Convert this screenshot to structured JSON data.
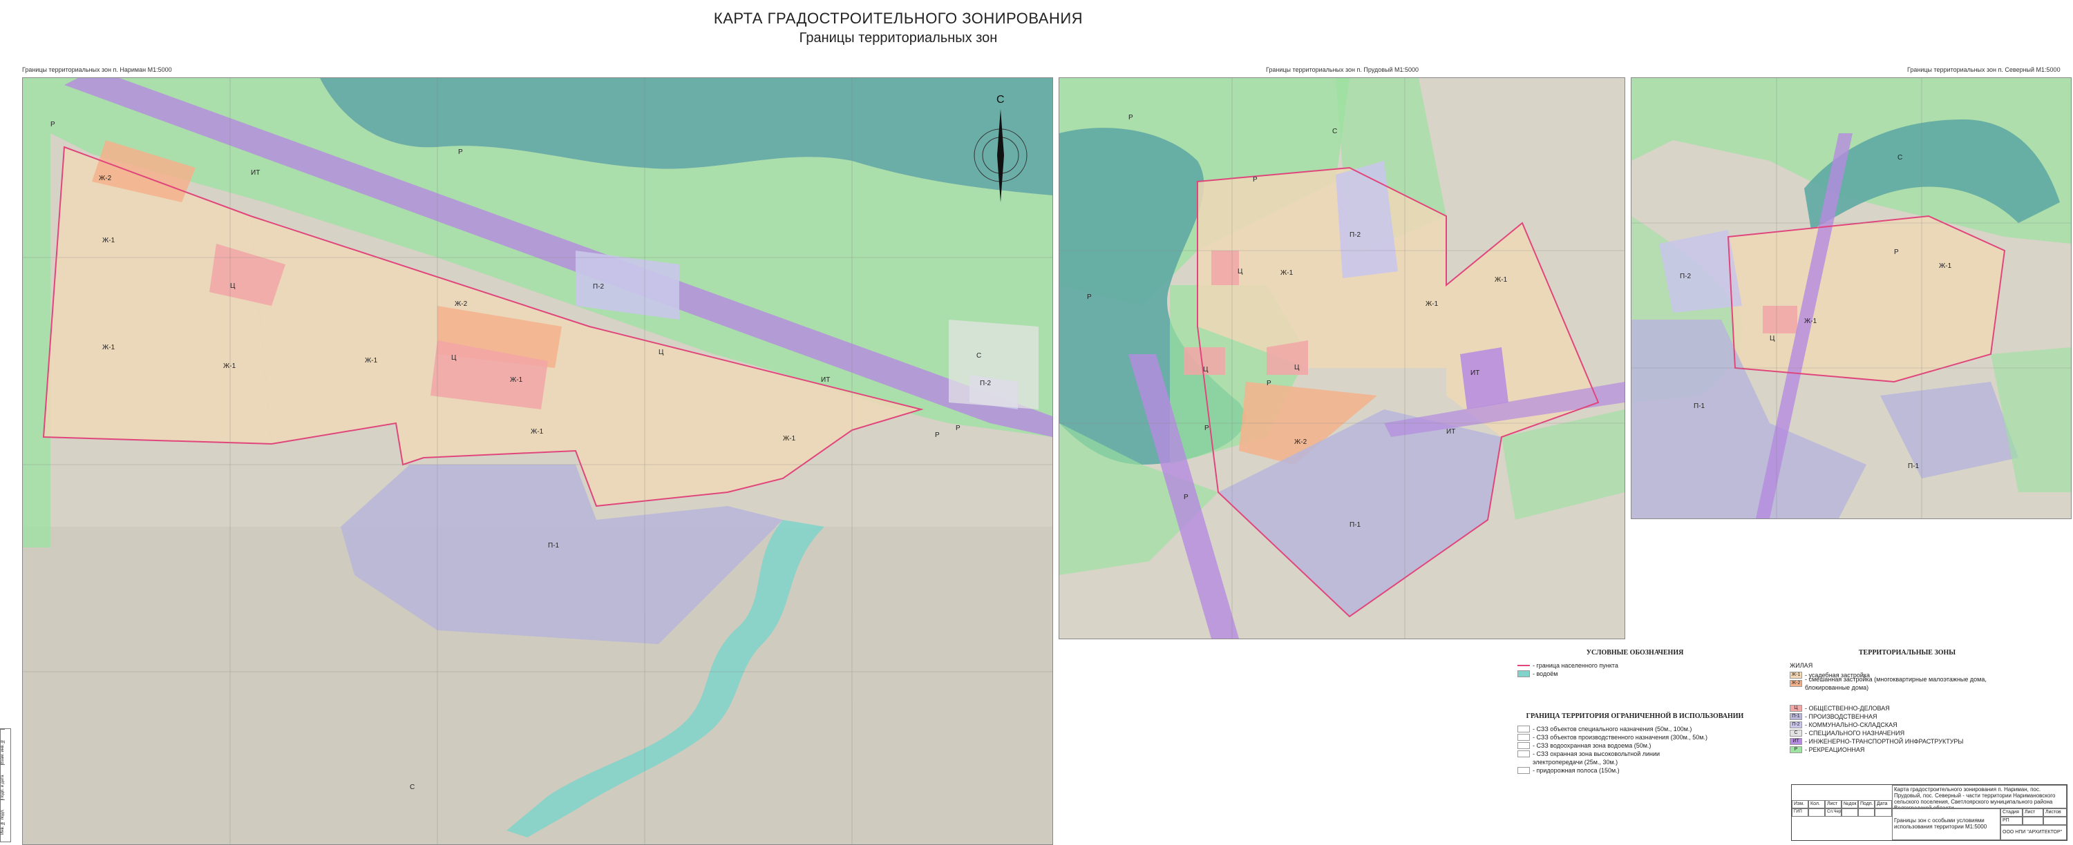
{
  "header": {
    "title": "КАРТА ГРАДОСТРОИТЕЛЬНОГО ЗОНИРОВАНИЯ",
    "subtitle": "Границы территориальных зон"
  },
  "maps": [
    {
      "caption": "Границы территориальных зон п. Нариман М1:5000",
      "north": "С",
      "labels": [
        "Р",
        "Ж-2",
        "ИТ",
        "Р",
        "Ж-1",
        "Ц",
        "Ж-1",
        "Ж-2",
        "Ц",
        "Ж-1",
        "Ж-1",
        "Ж-1",
        "П-2",
        "Ц",
        "Ж-1",
        "ИТ",
        "Ж-1",
        "Р",
        "С",
        "П-2",
        "Р",
        "П-1",
        "С"
      ]
    },
    {
      "caption": "Границы территориальных зон п. Прудовый М1:5000",
      "labels": [
        "Р",
        "С",
        "Р",
        "П-2",
        "Ж-1",
        "Ж-1",
        "Ж-1",
        "ИТ",
        "Ц",
        "Ц",
        "Ц",
        "Ж-2",
        "П-1",
        "Р",
        "Р",
        "Р",
        "ИТ",
        "Р"
      ]
    },
    {
      "caption": "Границы территориальных зон п. Северный М1:5000",
      "labels": [
        "С",
        "П-2",
        "Ж-1",
        "Ж-1",
        "Ц",
        "Р",
        "П-1",
        "П-1"
      ]
    }
  ],
  "legend_left": {
    "title": "УСЛОВНЫЕ ОБОЗНАЧЕНИЯ",
    "items": [
      {
        "label": "- граница населенного пункта",
        "kind": "line",
        "color": "#e0467c"
      },
      {
        "label": "- водоём",
        "kind": "fill",
        "color": "#7fd3c9"
      }
    ],
    "restricted_title": "ГРАНИЦА ТЕРРИТОРИЯ ОГРАНИЧЕННОЙ В ИСПОЛЬЗОВАНИИ",
    "restricted": [
      "- СЗЗ объектов специального назначения (50м., 100м.)",
      "- СЗЗ объектов производственного назначения (300м., 50м.)",
      "- СЗЗ водоохранная зона водоема (50м.)",
      "- СЗЗ охранная зона высоковольтной линии",
      "электропередачи (25м., 30м.)",
      "- придорожная полоса (150м.)"
    ]
  },
  "legend_right": {
    "title": "ТЕРРИТОРИАЛЬНЫЕ ЗОНЫ",
    "group_residential": "ЖИЛАЯ",
    "residential": [
      {
        "code": "Ж-1",
        "label": "- усадебная застройка",
        "color": "#f3d9b5"
      },
      {
        "code": "Ж-2",
        "label": "- смешанная застройка (многоквартирные малоэтажные дома, блокированные дома)",
        "color": "#f4b28c"
      }
    ],
    "zones": [
      {
        "code": "Ц",
        "label": "- ОБЩЕСТВЕННО-ДЕЛОВАЯ",
        "color": "#f2a6a6"
      },
      {
        "code": "П-1",
        "label": "- ПРОИЗВОДСТВЕННАЯ",
        "color": "#b9b6d9"
      },
      {
        "code": "П-2",
        "label": "- КОММУНАЛЬНО-СКЛАДСКАЯ",
        "color": "#c9c6ea"
      },
      {
        "code": "С",
        "label": "- СПЕЦИАЛЬНОГО НАЗНАЧЕНИЯ",
        "color": "#e2e2e2"
      },
      {
        "code": "ИТ",
        "label": "- ИНЖЕНЕРНО-ТРАНСПОРТНОЙ ИНФРАСТРУКТУРЫ",
        "color": "#b58be0"
      },
      {
        "code": "Р",
        "label": "- РЕКРЕАЦИОННАЯ",
        "color": "#9ee3a4"
      }
    ]
  },
  "stamp": {
    "project": "Карта градостроительного зонирования п. Нариман, пос. Прудовый, пос. Северный - части территории Наримановского сельского поселения, Светлоярского муниципального района Волгоградской области",
    "cols": [
      "Изм.",
      "Кол.",
      "Лист",
      "№док",
      "Подп.",
      "Дата"
    ],
    "row_values": [
      "ГИП",
      "",
      "Сл.Черданник",
      "",
      "",
      ""
    ],
    "stage_head": [
      "Стадия",
      "Лист",
      "Листов"
    ],
    "stage": [
      "РП",
      "",
      ""
    ],
    "sheet_name": "Границы зон с особыми условиями использования территории М1:5000",
    "company": "ООО НПИ \"АРХИТЕКТОР\""
  },
  "sidebox": [
    "Взам. инв. №",
    "Подп. и дата",
    "Инв. № подл."
  ],
  "colors": {
    "water": "#5fb3a8",
    "green": "#9be2a0",
    "land": "#d8d4c8",
    "residential": "#efd8b6",
    "boundary": "#e0467c",
    "transport": "#b58be0"
  }
}
